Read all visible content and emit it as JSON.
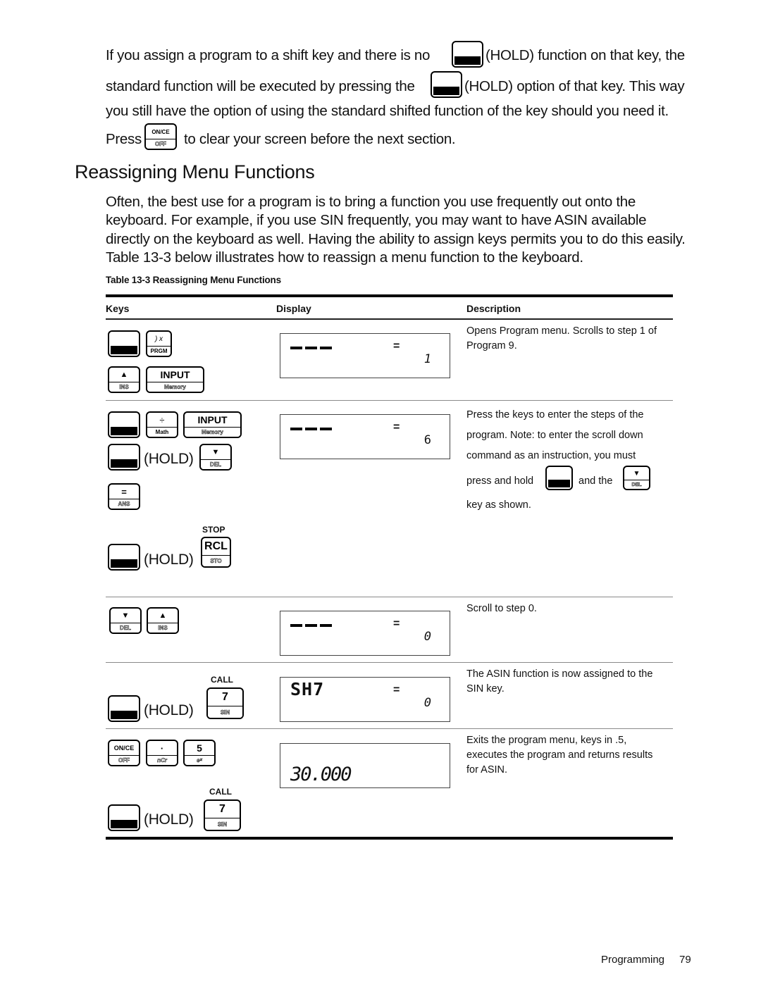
{
  "intro": {
    "line1_a": "If you assign a program to a shift key and there is no",
    "line1_b": "(HOLD) function on that key, the",
    "line2_a": "standard function will be executed by pressing the",
    "line2_b": "(HOLD) option of that key. This way",
    "line3": "you still have the option of using the standard shifted function of the key should you need it.",
    "line4_a": "Press",
    "line4_b": "to clear your screen before the next section."
  },
  "section": {
    "title": "Reassigning Menu Functions",
    "paragraph_lines": [
      "Often, the best use for a program is to bring a function you use frequently out onto the",
      "keyboard. For example, if you use SIN frequently, you may want to have ASIN available",
      "directly on the keyboard as well. Having the ability to assign keys permits you to do this easily.",
      "Table 13-3 below illustrates how to reassign a menu function to the keyboard."
    ]
  },
  "table": {
    "caption": "Table 13-3  Reassigning Menu Functions",
    "headers": {
      "keys": "Keys",
      "display": "Display",
      "description": "Description"
    },
    "hold_label": "(HOLD)",
    "rows": [
      {
        "description_lines": [
          "Opens Program menu. Scrolls to step 1 of",
          "Program 9."
        ],
        "display": {
          "top": "---",
          "eq": "=",
          "value": "1"
        }
      },
      {
        "description_lines": [
          "Press the keys to enter the steps of the",
          "program. Note: to enter the scroll down",
          "command as an instruction, you must"
        ],
        "description_inline_a": "press and hold",
        "description_inline_b": "and the",
        "description_end": "key as shown.",
        "display": {
          "top": "---",
          "eq": "=",
          "value": "6"
        }
      },
      {
        "description_lines": [
          "Scroll to step 0."
        ],
        "display": {
          "top": "---",
          "eq": "=",
          "value": "0"
        }
      },
      {
        "description_lines": [
          "The ASIN function is now assigned to the",
          "SIN key."
        ],
        "display": {
          "top": "SH7",
          "eq": "=",
          "value": "0"
        }
      },
      {
        "description_lines": [
          "Exits the program menu, keys in .5,",
          "executes the program and returns results",
          "for ASIN."
        ],
        "display": {
          "result": "30.000"
        }
      }
    ]
  },
  "keys": {
    "prgm": {
      "top": ") x",
      "bottom": "PRGM"
    },
    "up_ins": {
      "top": "▲",
      "bottom": "INS"
    },
    "input_memory": {
      "top": "INPUT",
      "bottom": "Memory"
    },
    "div_math": {
      "top": "÷",
      "bottom": "Math"
    },
    "down_del": {
      "top": "▼",
      "bottom": "DEL"
    },
    "eq_ans": {
      "top": "=",
      "bottom": "ANS"
    },
    "rcl_sto": {
      "over": "STOP",
      "top": "RCL",
      "bottom": "STO"
    },
    "seven_sin": {
      "over": "CALL",
      "top": "7",
      "bottom": "SIN"
    },
    "on_off": {
      "top": "ON/CE",
      "bottom": "OFF"
    },
    "dot_ncr": {
      "top": "·",
      "bottom": "nCr"
    },
    "five_ex": {
      "top": "5",
      "bottom": "eˣ"
    }
  },
  "footer": {
    "section": "Programming",
    "page": "79"
  }
}
